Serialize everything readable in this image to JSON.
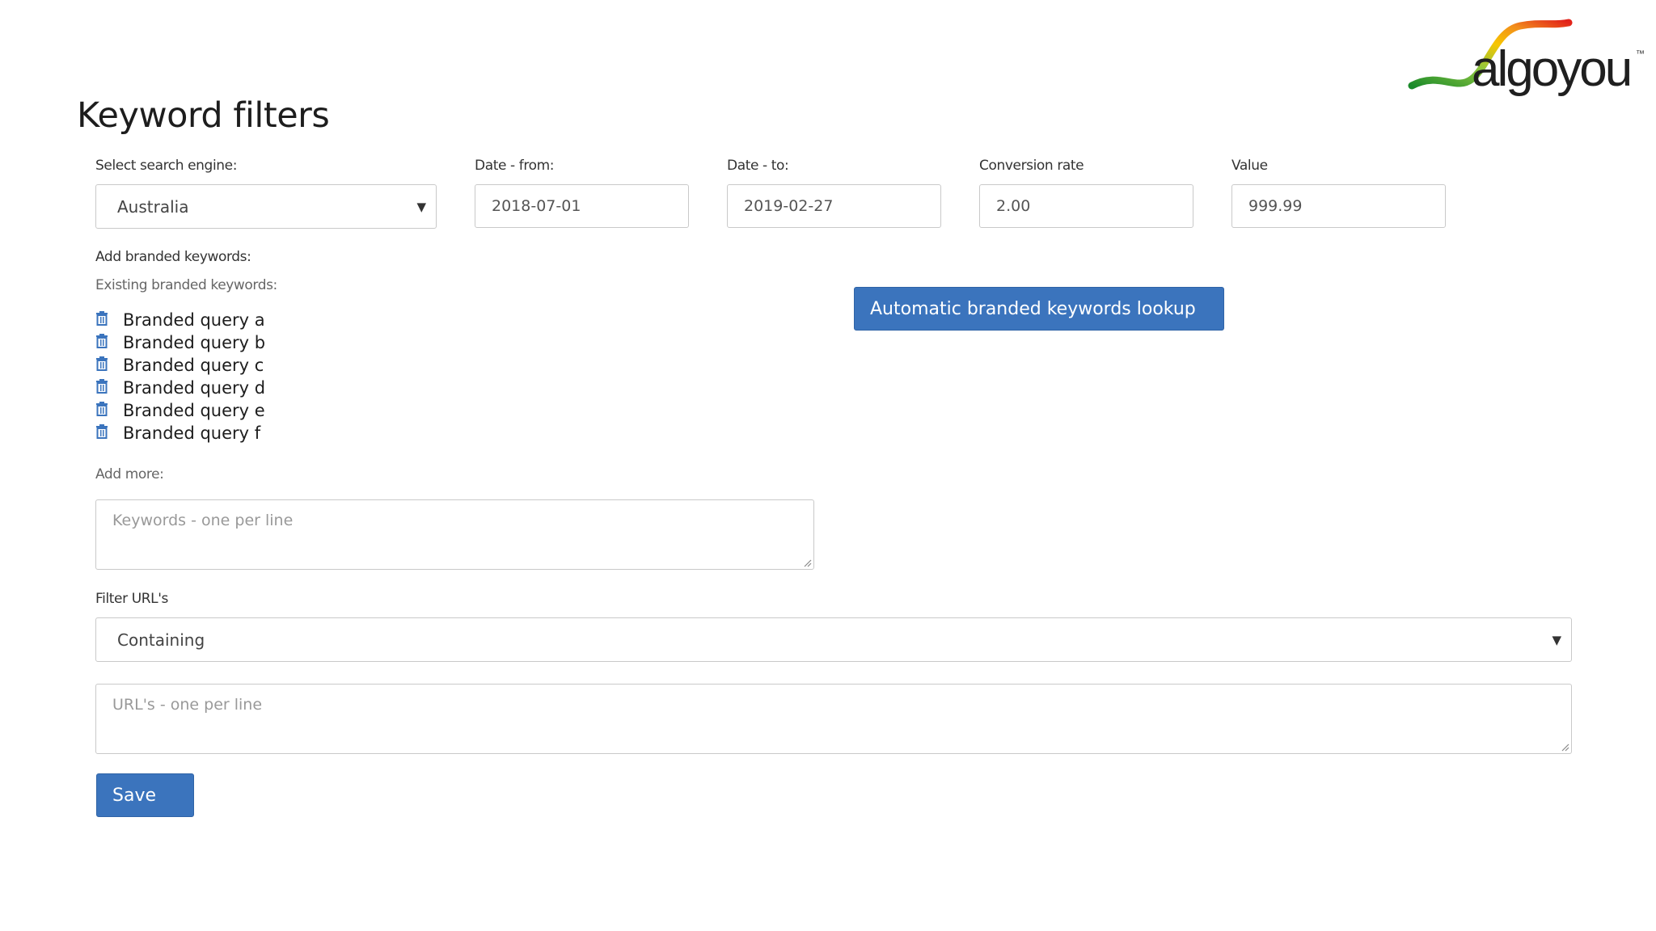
{
  "brand": {
    "logo_text": "algoyou",
    "trademark": "™"
  },
  "page": {
    "title": "Keyword filters"
  },
  "filters": {
    "search_engine": {
      "label": "Select search engine:",
      "selected": "Australia"
    },
    "date_from": {
      "label": "Date - from:",
      "value": "2018-07-01"
    },
    "date_to": {
      "label": "Date - to:",
      "value": "2019-02-27"
    },
    "conversion_rate": {
      "label": "Conversion rate",
      "value": "2.00"
    },
    "value": {
      "label": "Value",
      "value": "999.99"
    }
  },
  "branded": {
    "section_label": "Add branded keywords:",
    "existing_label": "Existing branded keywords:",
    "keywords": [
      "Branded query a",
      "Branded query b",
      "Branded query c",
      "Branded query d",
      "Branded query e",
      "Branded query f"
    ],
    "lookup_button": "Automatic branded keywords lookup",
    "add_more_label": "Add more:",
    "add_more_placeholder": "Keywords - one per line"
  },
  "url_filter": {
    "label": "Filter URL's",
    "selected": "Containing",
    "placeholder": "URL's - one per line"
  },
  "actions": {
    "save": "Save"
  },
  "colors": {
    "primary_button": "#3b74bd",
    "trash_icon": "#3b74bd"
  }
}
